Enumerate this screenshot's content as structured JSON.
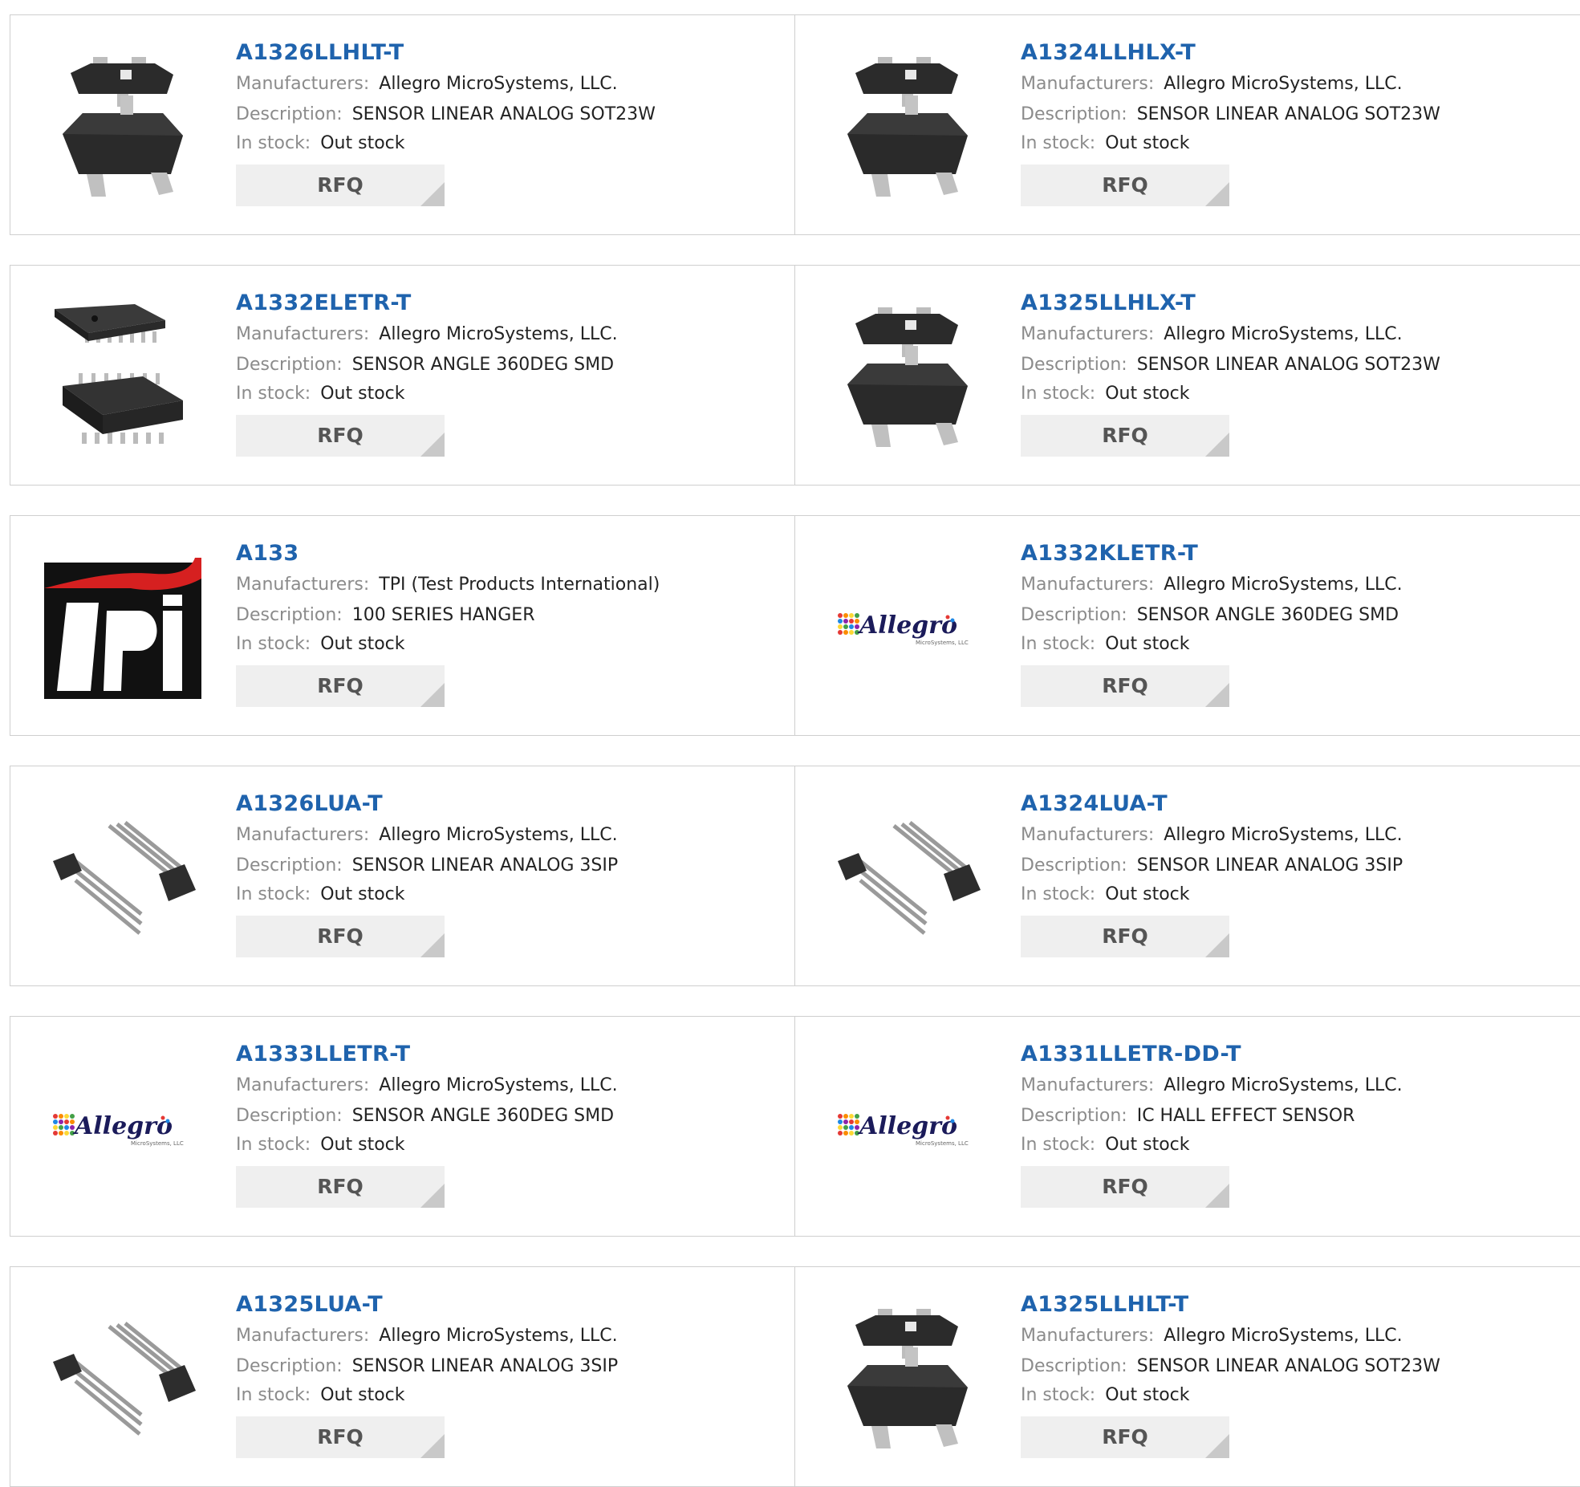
{
  "labels": {
    "manufacturers": "Manufacturers:",
    "description": "Description:",
    "in_stock": "In stock:",
    "rfq": "RFQ"
  },
  "products": [
    {
      "part": "A1326LLHLT-T",
      "manufacturer": "Allegro MicroSystems, LLC.",
      "description": "SENSOR LINEAR ANALOG SOT23W",
      "stock": "Out stock",
      "image": "sot23-package-icon"
    },
    {
      "part": "A1324LLHLX-T",
      "manufacturer": "Allegro MicroSystems, LLC.",
      "description": "SENSOR LINEAR ANALOG SOT23W",
      "stock": "Out stock",
      "image": "sot23-package-icon"
    },
    {
      "part": "A1332ELETR-T",
      "manufacturer": "Allegro MicroSystems, LLC.",
      "description": "SENSOR ANGLE 360DEG SMD",
      "stock": "Out stock",
      "image": "tssop-package-icon"
    },
    {
      "part": "A1325LLHLX-T",
      "manufacturer": "Allegro MicroSystems, LLC.",
      "description": "SENSOR LINEAR ANALOG SOT23W",
      "stock": "Out stock",
      "image": "sot23-package-icon"
    },
    {
      "part": "A133",
      "manufacturer": "TPI (Test Products International)",
      "description": "100 SERIES HANGER",
      "stock": "Out stock",
      "image": "tpi-logo"
    },
    {
      "part": "A1332KLETR-T",
      "manufacturer": "Allegro MicroSystems, LLC.",
      "description": "SENSOR ANGLE 360DEG SMD",
      "stock": "Out stock",
      "image": "allegro-logo"
    },
    {
      "part": "A1326LUA-T",
      "manufacturer": "Allegro MicroSystems, LLC.",
      "description": "SENSOR LINEAR ANALOG 3SIP",
      "stock": "Out stock",
      "image": "sip3-package-icon"
    },
    {
      "part": "A1324LUA-T",
      "manufacturer": "Allegro MicroSystems, LLC.",
      "description": "SENSOR LINEAR ANALOG 3SIP",
      "stock": "Out stock",
      "image": "sip3-package-icon"
    },
    {
      "part": "A1333LLETR-T",
      "manufacturer": "Allegro MicroSystems, LLC.",
      "description": "SENSOR ANGLE 360DEG SMD",
      "stock": "Out stock",
      "image": "allegro-logo"
    },
    {
      "part": "A1331LLETR-DD-T",
      "manufacturer": "Allegro MicroSystems, LLC.",
      "description": "IC HALL EFFECT SENSOR",
      "stock": "Out stock",
      "image": "allegro-logo"
    },
    {
      "part": "A1325LUA-T",
      "manufacturer": "Allegro MicroSystems, LLC.",
      "description": "SENSOR LINEAR ANALOG 3SIP",
      "stock": "Out stock",
      "image": "sip3-package-icon"
    },
    {
      "part": "A1325LLHLT-T",
      "manufacturer": "Allegro MicroSystems, LLC.",
      "description": "SENSOR LINEAR ANALOG SOT23W",
      "stock": "Out stock",
      "image": "sot23-package-icon"
    }
  ],
  "logos": {
    "tpi": "tpi",
    "allegro": "Allegro",
    "allegro_sub": "MicroSystems, LLC"
  },
  "colors": {
    "part_link": "#1f63ad",
    "label": "#8b8b8b",
    "value": "#222222",
    "border": "#cfcfcf",
    "rfq_bg": "#efefef"
  }
}
